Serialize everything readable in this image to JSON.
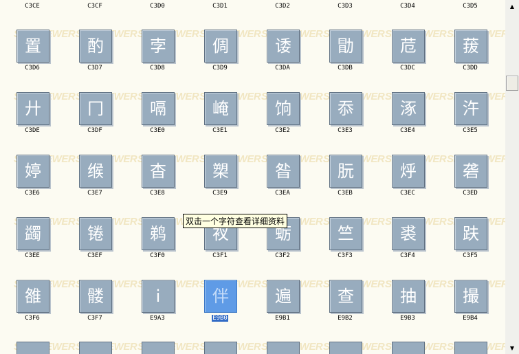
{
  "watermark": "SHX VIEWER",
  "tooltip": "双击一个字符查看详细资料",
  "top_codes": [
    "C3CE",
    "C3CF",
    "C3D0",
    "C3D1",
    "C3D2",
    "C3D3",
    "C3D4",
    "C3D5"
  ],
  "rows": [
    [
      {
        "c": "C3D6",
        "g": "置"
      },
      {
        "c": "C3D7",
        "g": "酌"
      },
      {
        "c": "C3D8",
        "g": "孛"
      },
      {
        "c": "C3D9",
        "g": "倜"
      },
      {
        "c": "C3DA",
        "g": "诿"
      },
      {
        "c": "C3DB",
        "g": "勖"
      },
      {
        "c": "C3DC",
        "g": "苊"
      },
      {
        "c": "C3DD",
        "g": "菝"
      }
    ],
    [
      {
        "c": "C3DE",
        "g": "廾"
      },
      {
        "c": "C3DF",
        "g": "冂"
      },
      {
        "c": "C3E0",
        "g": "嗝"
      },
      {
        "c": "C3E1",
        "g": "崦"
      },
      {
        "c": "C3E2",
        "g": "饷"
      },
      {
        "c": "C3E3",
        "g": "忝"
      },
      {
        "c": "C3E4",
        "g": "涿"
      },
      {
        "c": "C3E5",
        "g": "汻"
      }
    ],
    [
      {
        "c": "C3E6",
        "g": "婷"
      },
      {
        "c": "C3E7",
        "g": "缑"
      },
      {
        "c": "C3E8",
        "g": "杳"
      },
      {
        "c": "C3E9",
        "g": "槊"
      },
      {
        "c": "C3EA",
        "g": "昝"
      },
      {
        "c": "C3EB",
        "g": "朊"
      },
      {
        "c": "C3EC",
        "g": "烀"
      },
      {
        "c": "C3ED",
        "g": "砻"
      }
    ],
    [
      {
        "c": "C3EE",
        "g": "蠲"
      },
      {
        "c": "C3EF",
        "g": "锩"
      },
      {
        "c": "C3F0",
        "g": "鹈"
      },
      {
        "c": "C3F1",
        "g": "衩"
      },
      {
        "c": "C3F2",
        "g": "蛎"
      },
      {
        "c": "C3F3",
        "g": "竺"
      },
      {
        "c": "C3F4",
        "g": "裘"
      },
      {
        "c": "C3F5",
        "g": "趺"
      }
    ],
    [
      {
        "c": "C3F6",
        "g": "雒"
      },
      {
        "c": "C3F7",
        "g": "髅"
      },
      {
        "c": "E9A3",
        "g": "i"
      },
      {
        "c": "E9B0",
        "g": "伴",
        "selected": true
      },
      {
        "c": "E9B1",
        "g": "遍"
      },
      {
        "c": "E9B2",
        "g": "查"
      },
      {
        "c": "E9B3",
        "g": "抽"
      },
      {
        "c": "E9B4",
        "g": "撮"
      }
    ]
  ],
  "scrollbar": {
    "up_icon": "▲",
    "down_icon": "▼"
  }
}
